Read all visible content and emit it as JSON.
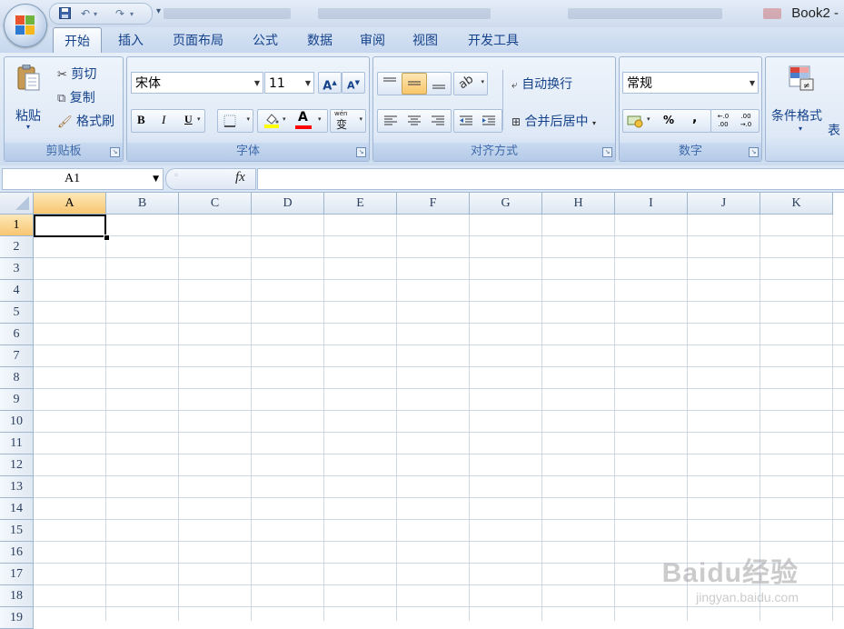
{
  "window": {
    "title": "Book2 -"
  },
  "quick_access": {
    "icons": [
      "save-icon",
      "undo-icon",
      "redo-icon",
      "customize-icon"
    ]
  },
  "tabs": [
    {
      "label": "开始",
      "active": true
    },
    {
      "label": "插入"
    },
    {
      "label": "页面布局"
    },
    {
      "label": "公式"
    },
    {
      "label": "数据"
    },
    {
      "label": "审阅"
    },
    {
      "label": "视图"
    },
    {
      "label": "开发工具"
    }
  ],
  "clipboard": {
    "paste": "粘贴",
    "cut": "剪切",
    "copy": "复制",
    "format_painter": "格式刷",
    "label": "剪贴板"
  },
  "font": {
    "name": "宋体",
    "size": "11",
    "bold": "B",
    "italic": "I",
    "underline": "U",
    "grow": "A",
    "shrink": "A",
    "color_letter": "A",
    "phonetic": "wén",
    "phonetic_char": "变",
    "label": "字体",
    "fill_color": "#ffff00",
    "font_color": "#ff0000"
  },
  "alignment": {
    "wrap_text": "自动换行",
    "merge_center": "合并后居中",
    "label": "对齐方式"
  },
  "number": {
    "format": "常规",
    "percent": "%",
    "comma": ",",
    "inc_decimal": "←.0 .00",
    "dec_decimal": ".00 →.0",
    "label": "数字"
  },
  "styles": {
    "conditional_formatting": "条件格式",
    "table_format": "表"
  },
  "formula_bar": {
    "name_box": "A1",
    "fx": "fx"
  },
  "sheet": {
    "columns": [
      "A",
      "B",
      "C",
      "D",
      "E",
      "F",
      "G",
      "H",
      "I",
      "J",
      "K"
    ],
    "rows": [
      "1",
      "2",
      "3",
      "4",
      "5",
      "6",
      "7",
      "8",
      "9",
      "10",
      "11",
      "12",
      "13",
      "14",
      "15",
      "16",
      "17",
      "18",
      "19"
    ],
    "selected_cell": "A1"
  },
  "watermark": {
    "brand": "Baidu经验",
    "url": "jingyan.baidu.com"
  }
}
